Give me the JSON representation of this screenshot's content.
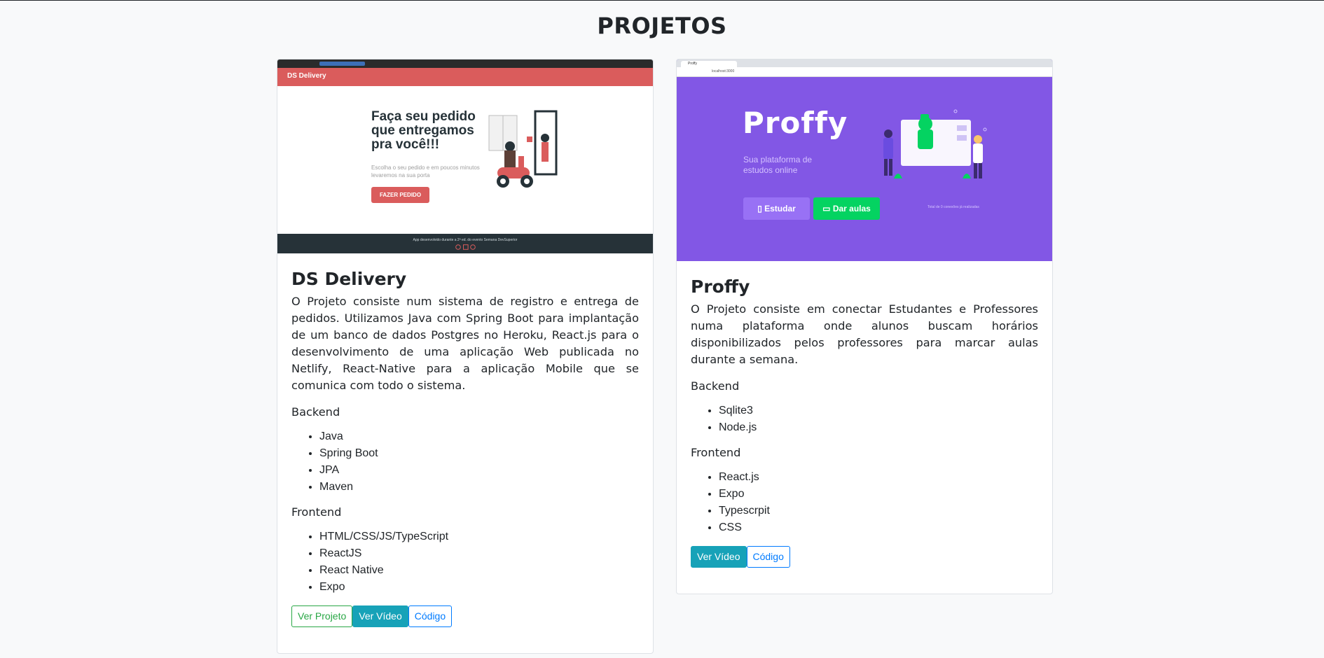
{
  "page": {
    "title": "PROJETOS"
  },
  "projects": [
    {
      "title": "DS Delivery",
      "description": "O Projeto consiste num sistema de registro e entrega de pedidos. Utilizamos Java com Spring Boot para implantação de um banco de dados Postgres no Heroku, React.js para o desenvolvimento de uma aplicação Web publicada no Netlify, React-Native para a aplicação Mobile que se comunica com todo o sistema.",
      "backend_label": "Backend",
      "backend": [
        "Java",
        "Spring Boot",
        "JPA",
        "Maven"
      ],
      "frontend_label": "Frontend",
      "frontend": [
        "HTML/CSS/JS/TypeScript",
        "ReactJS",
        "React Native",
        "Expo"
      ],
      "buttons": {
        "project": "Ver Projeto",
        "video": "Ver Vídeo",
        "code": "Código"
      },
      "screenshot": {
        "brand": "DS Delivery",
        "headline": "Faça seu pedido que entregamos pra você!!!",
        "subtitle": "Escolha o seu pedido e em poucos minutos levaremos na sua porta",
        "cta": "FAZER PEDIDO",
        "footer": "App desenvolvido durante a 2ª ed. do evento Semana DevSuperior",
        "accent_color": "#da5c5c",
        "footer_color": "#263238"
      }
    },
    {
      "title": "Proffy",
      "description": "O Projeto consiste em conectar Estudantes e Professores numa plataforma onde alunos buscam horários disponibilizados pelos professores para marcar aulas durante a semana.",
      "backend_label": "Backend",
      "backend": [
        "Sqlite3",
        "Node.js"
      ],
      "frontend_label": "Frontend",
      "frontend": [
        "React.js",
        "Expo",
        "Typescrpit",
        "CSS"
      ],
      "buttons": {
        "video": "Ver Vídeo",
        "code": "Código"
      },
      "screenshot": {
        "tab": "Proffy",
        "url": "localhost:3000",
        "logo": "Proffy",
        "tagline": "Sua plataforma de estudos online",
        "study": "Estudar",
        "teach": "Dar aulas",
        "connections": "Total de 0 conexões já realizadas",
        "bg_color": "#8257e5",
        "teach_color": "#04d361"
      }
    }
  ],
  "colors": {
    "success": "#28a745",
    "info": "#17a2b8",
    "primary": "#007bff",
    "background": "#f8f9fa"
  }
}
